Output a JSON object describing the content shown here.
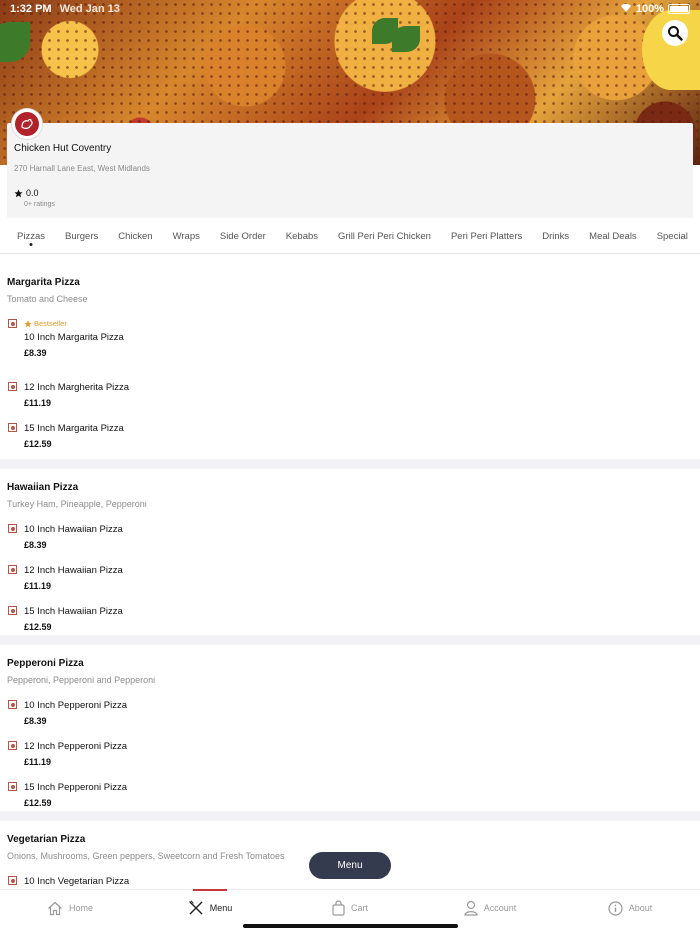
{
  "status": {
    "time": "1:32 PM",
    "carrier": "Wed Jan 13",
    "battery": "100%"
  },
  "restaurant": {
    "name": "Chicken Hut Coventry",
    "address": "270 Harnall Lane East, West Midlands",
    "rating": "0.0",
    "rating_count": "0+ ratings"
  },
  "tabs": [
    {
      "label": "Pizzas",
      "active": true
    },
    {
      "label": "Burgers"
    },
    {
      "label": "Chicken"
    },
    {
      "label": "Wraps"
    },
    {
      "label": "Side Order"
    },
    {
      "label": "Kebabs"
    },
    {
      "label": "Grill Peri Peri Chicken"
    },
    {
      "label": "Peri Peri Platters"
    },
    {
      "label": "Drinks"
    },
    {
      "label": "Meal Deals"
    },
    {
      "label": "Special"
    }
  ],
  "sections": [
    {
      "title": "Margarita Pizza",
      "desc": "Tomato and Cheese",
      "items": [
        {
          "badge": "Bestseller",
          "name": "10 Inch Margarita Pizza",
          "price": "£8.39"
        },
        {
          "name": "12 Inch Margherita Pizza",
          "price": "£11.19"
        },
        {
          "name": "15 Inch Margarita Pizza",
          "price": "£12.59"
        }
      ]
    },
    {
      "title": "Hawaiian Pizza",
      "desc": "Turkey Ham, Pineapple, Pepperoni",
      "items": [
        {
          "name": "10 Inch Hawaiian Pizza",
          "price": "£8.39"
        },
        {
          "name": "12 Inch Hawaiian Pizza",
          "price": "£11.19"
        },
        {
          "name": "15 Inch Hawaiian Pizza",
          "price": "£12.59"
        }
      ]
    },
    {
      "title": "Pepperoni Pizza",
      "desc": "Pepperoni, Pepperoni and Pepperoni",
      "items": [
        {
          "name": "10 Inch Pepperoni Pizza",
          "price": "£8.39"
        },
        {
          "name": "12 Inch Pepperoni Pizza",
          "price": "£11.19"
        },
        {
          "name": "15 Inch Pepperoni Pizza",
          "price": "£12.59"
        }
      ]
    },
    {
      "title": "Vegetarian Pizza",
      "desc": "Onions, Mushrooms, Green peppers, Sweetcorn and Fresh Tomatoes",
      "items": [
        {
          "name": "10 Inch Vegetarian Pizza"
        }
      ]
    }
  ],
  "float_button": "Menu",
  "nav": [
    {
      "label": "Home",
      "icon": "home-icon"
    },
    {
      "label": "Menu",
      "icon": "utensils-icon",
      "active": true
    },
    {
      "label": "Cart",
      "icon": "bag-icon"
    },
    {
      "label": "Account",
      "icon": "user-icon"
    },
    {
      "label": "About",
      "icon": "info-icon"
    }
  ],
  "colors": {
    "accent": "#c8363c",
    "veg_marker": "#b85545",
    "bestseller": "#e79a2a",
    "float_button": "#343b4f"
  }
}
